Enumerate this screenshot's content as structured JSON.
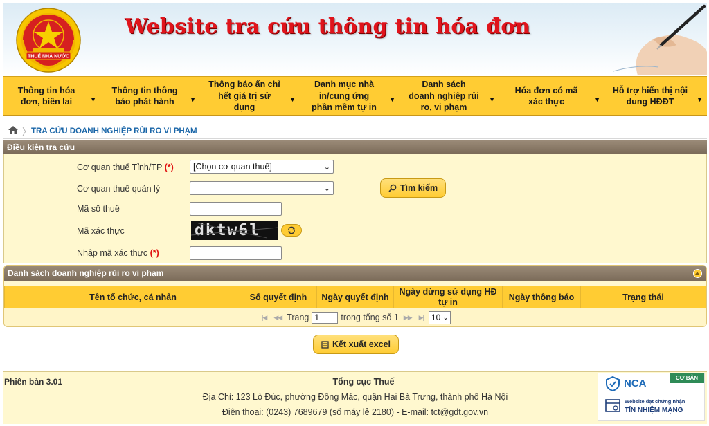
{
  "header": {
    "logo_text": "THUẾ NHÀ NƯỚC",
    "site_title": "Website tra cứu thông tin hóa đơn"
  },
  "nav": {
    "items": [
      {
        "label": "Thông tin hóa đơn, biên lai"
      },
      {
        "label": "Thông tin thông báo phát hành"
      },
      {
        "label": "Thông báo ấn chỉ hết giá trị sử dụng"
      },
      {
        "label": "Danh mục nhà in/cung ứng phần mềm tự in"
      },
      {
        "label": "Danh sách doanh nghiệp rủi ro, vi phạm"
      },
      {
        "label": "Hóa đơn có mã xác thực"
      },
      {
        "label": "Hỗ trợ hiển thị nội dung HĐĐT"
      }
    ]
  },
  "breadcrumb": {
    "current": "TRA CỨU DOANH NGHIỆP RỦI RO VI PHẠM"
  },
  "search": {
    "panel_title": "Điều kiện tra cứu",
    "province_label": "Cơ quan thuế Tỉnh/TP",
    "required_mark": "(*)",
    "province_value": "[Chọn cơ quan thuế]",
    "managing_label": "Cơ quan thuế quản lý",
    "managing_value": "",
    "tax_code_label": "Mã số thuế",
    "captcha_label": "Mã xác thực",
    "captcha_text": "dktw6l",
    "captcha_input_label": "Nhập mã xác thực",
    "search_button": "Tìm kiếm"
  },
  "results": {
    "panel_title": "Danh sách doanh nghiệp rủi ro vi phạm",
    "columns": [
      "",
      "Tên tổ chức, cá nhân",
      "Số quyết định",
      "Ngày quyết định",
      "Ngày dừng sử dụng HĐ tự in",
      "Ngày thông báo",
      "Trạng thái"
    ],
    "pager": {
      "page_label": "Trang",
      "page_value": "1",
      "of_label": "trong tổng số 1",
      "page_size": "10"
    }
  },
  "export_button": "Kết xuất excel",
  "footer": {
    "version": "Phiên bản 3.01",
    "org": "Tổng cục Thuế",
    "address": "Địa Chỉ: 123 Lò Đúc, phường Đống Mác, quận Hai Bà Trưng, thành phố Hà Nội",
    "contact": "Điện thoại: (0243) 7689679 (số máy lẻ 2180) - E-mail: tct@gdt.gov.vn",
    "nca": {
      "logo": "NCA",
      "badge": "CƠ BẢN",
      "line1": "Website đạt chứng nhận",
      "line2": "TÍN NHIỆM MẠNG"
    }
  },
  "colors": {
    "nav_bg": "#ffcc33",
    "panel_head": "#8a7a68",
    "title_red": "#e0141c",
    "link_blue": "#1a66a8"
  }
}
